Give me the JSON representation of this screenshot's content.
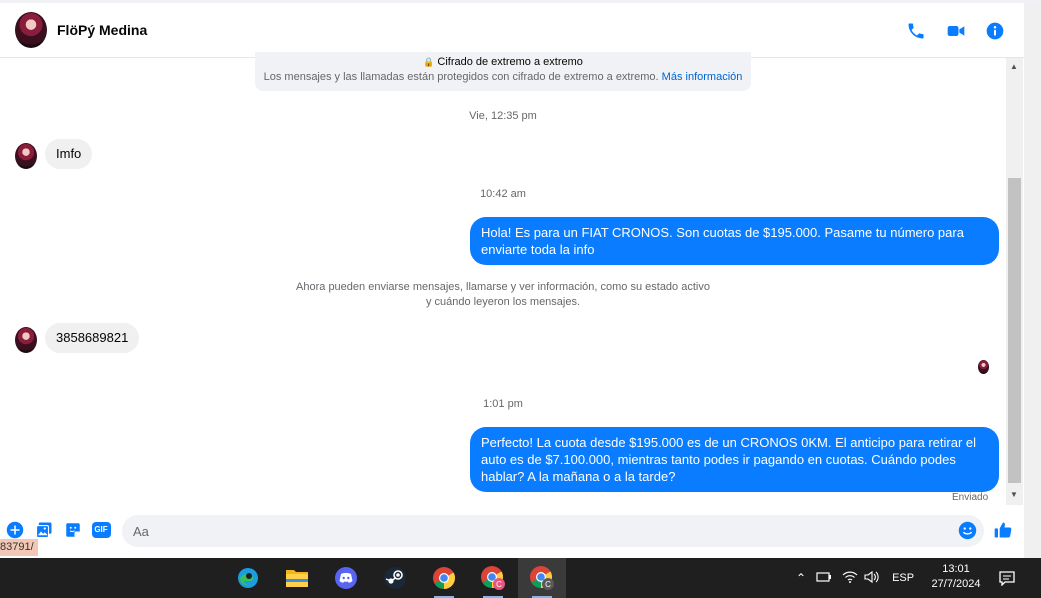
{
  "header": {
    "contact_name": "FlöPý Medina",
    "icons": [
      "phone-icon",
      "video-icon",
      "info-icon"
    ]
  },
  "encryption": {
    "title": "Cifrado de extremo a extremo",
    "text": "Los mensajes y las llamadas están protegidos con cifrado de extremo a extremo.",
    "link": "Más información"
  },
  "conversation": {
    "timestamp_1": "Vie, 12:35 pm",
    "msg_in_1": "Imfo",
    "timestamp_2": "10:42 am",
    "msg_out_1": "Hola! Es para un FIAT CRONOS. Son cuotas de $195.000. Pasame tu número para enviarte toda la info",
    "system_line_1": "Ahora pueden enviarse mensajes, llamarse y ver información, como su estado activo",
    "system_line_2": "y cuándo leyeron los mensajes.",
    "msg_in_2": "3858689821",
    "timestamp_3": "1:01 pm",
    "msg_out_2": "Perfecto! La cuota desde $195.000 es de un CRONOS 0KM. El anticipo para retirar el auto es de $7.100.000, mientras tanto podes ir pagando en cuotas. Cuándo podes hablar? A la mañana o a la tarde?",
    "status": "Enviado"
  },
  "composer": {
    "placeholder": "Aa",
    "icons": [
      "plus-icon",
      "gallery-icon",
      "sticker-icon",
      "gif-icon",
      "emoji-icon",
      "like-icon"
    ],
    "gif_label": "GIF"
  },
  "url_tooltip": "83791/",
  "taskbar": {
    "apps": [
      "edge-icon",
      "file-explorer-icon",
      "discord-icon",
      "steam-icon",
      "chrome-icon",
      "chrome-profile-icon",
      "chrome-active-icon"
    ],
    "language": "ESP",
    "time": "13:01",
    "date": "27/7/2024"
  },
  "colors": {
    "accent": "#0a7cff",
    "incoming_bubble": "#f0f0f0",
    "taskbar": "#1f1f1f"
  }
}
